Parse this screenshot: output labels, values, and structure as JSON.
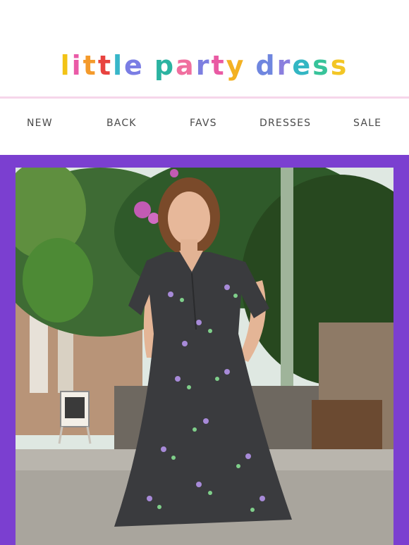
{
  "brand": {
    "logo_text": "little party dress",
    "logo_letters": [
      {
        "ch": "l",
        "color": "#f2c316"
      },
      {
        "ch": "i",
        "color": "#ea5aa7"
      },
      {
        "ch": "t",
        "color": "#f49a2b"
      },
      {
        "ch": "t",
        "color": "#e8433f"
      },
      {
        "ch": "l",
        "color": "#38b6c9"
      },
      {
        "ch": "e",
        "color": "#7a7de4"
      },
      {
        "ch": " ",
        "color": "#ffffff"
      },
      {
        "ch": "p",
        "color": "#2bb3a1"
      },
      {
        "ch": "a",
        "color": "#f06f9f"
      },
      {
        "ch": "r",
        "color": "#7d7fe0"
      },
      {
        "ch": "t",
        "color": "#e95aa3"
      },
      {
        "ch": "y",
        "color": "#f3b122"
      },
      {
        "ch": " ",
        "color": "#ffffff"
      },
      {
        "ch": "d",
        "color": "#6f86df"
      },
      {
        "ch": "r",
        "color": "#8a7fde"
      },
      {
        "ch": "e",
        "color": "#33b6c3"
      },
      {
        "ch": "s",
        "color": "#37c39a"
      },
      {
        "ch": "s",
        "color": "#f3c625"
      }
    ]
  },
  "nav": {
    "items": [
      {
        "label": "NEW",
        "key": "new"
      },
      {
        "label": "BACK",
        "key": "back"
      },
      {
        "label": "FAVS",
        "key": "favs"
      },
      {
        "label": "DRESSES",
        "key": "dresses"
      },
      {
        "label": "SALE",
        "key": "sale"
      }
    ]
  },
  "colors": {
    "frame_purple": "#7b3fd0",
    "divider_pink": "#f6d6ea",
    "nav_text": "#4a4a4a",
    "dress": "#3a3b3e"
  },
  "hero": {
    "image_subject": "woman-in-floral-dress-photo"
  }
}
